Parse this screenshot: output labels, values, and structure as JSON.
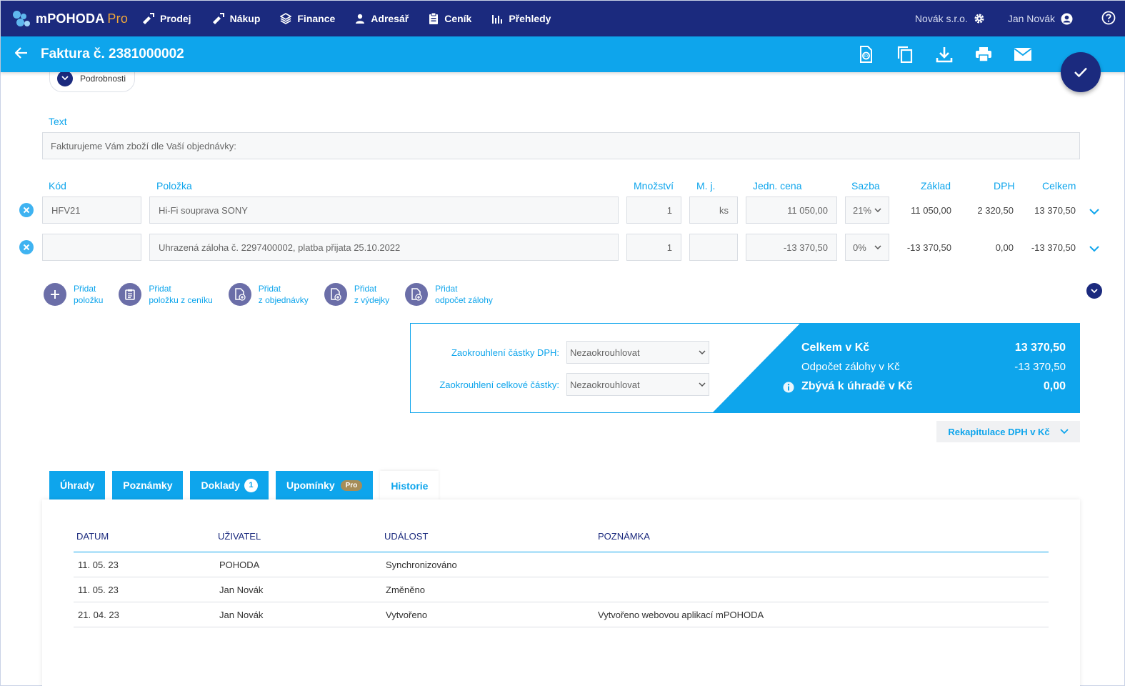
{
  "nav": {
    "app_name": "mPOHODA",
    "app_suffix": "Pro",
    "items": [
      {
        "label": "Prodej",
        "icon": "sell-icon"
      },
      {
        "label": "Nákup",
        "icon": "purchase-icon"
      },
      {
        "label": "Finance",
        "icon": "finance-icon"
      },
      {
        "label": "Adresář",
        "icon": "person-icon"
      },
      {
        "label": "Ceník",
        "icon": "pricelist-icon"
      },
      {
        "label": "Přehledy",
        "icon": "chart-icon"
      }
    ],
    "company": "Novák s.r.o.",
    "user": "Jan Novák"
  },
  "header": {
    "title": "Faktura č. 2381000002",
    "actions": [
      "isdoc-icon",
      "copy-icon",
      "download-icon",
      "print-icon",
      "email-icon"
    ]
  },
  "details_toggle": "Podrobnosti",
  "text_section": {
    "label": "Text",
    "value": "Fakturujeme Vám zboží dle Vaší objednávky:"
  },
  "items_table": {
    "headers": {
      "code": "Kód",
      "item": "Položka",
      "qty": "Množství",
      "unit": "M. j.",
      "unit_price": "Jedn. cena",
      "rate": "Sazba",
      "base": "Základ",
      "vat": "DPH",
      "total": "Celkem"
    },
    "rows": [
      {
        "code": "HFV21",
        "item": "Hi-Fi souprava SONY",
        "qty": "1",
        "unit": "ks",
        "unit_price": "11 050,00",
        "rate": "21%",
        "base": "11 050,00",
        "vat": "2 320,50",
        "total": "13 370,50"
      },
      {
        "code": "",
        "item": "Uhrazená záloha č. 2297400002, platba přijata 25.10.2022",
        "qty": "1",
        "unit": "",
        "unit_price": "-13 370,50",
        "rate": "0%",
        "base": "-13 370,50",
        "vat": "0,00",
        "total": "-13 370,50"
      }
    ]
  },
  "add_actions": [
    {
      "line1": "Přidat",
      "line2": "položku",
      "icon": "plus-icon"
    },
    {
      "line1": "Přidat",
      "line2": "položku z ceníku",
      "icon": "clipboard-icon"
    },
    {
      "line1": "Přidat",
      "line2": "z objednávky",
      "icon": "order-doc-icon"
    },
    {
      "line1": "Přidat",
      "line2": "z výdejky",
      "icon": "issue-doc-icon"
    },
    {
      "line1": "Přidat",
      "line2": "odpočet zálohy",
      "icon": "deposit-doc-icon"
    }
  ],
  "rounding": {
    "vat_label": "Zaokrouhlení částky DPH:",
    "vat_value": "Nezaokrouhlovat",
    "total_label": "Zaokrouhlení celkové částky:",
    "total_value": "Nezaokrouhlovat"
  },
  "totals": {
    "total_label": "Celkem v Kč",
    "total_value": "13 370,50",
    "deposit_label": "Odpočet zálohy v Kč",
    "deposit_value": "-13 370,50",
    "remaining_label": "Zbývá k úhradě v Kč",
    "remaining_value": "0,00"
  },
  "recap_label": "Rekapitulace DPH v Kč",
  "tabs": [
    {
      "label": "Úhrady"
    },
    {
      "label": "Poznámky"
    },
    {
      "label": "Doklady",
      "badge": "1"
    },
    {
      "label": "Upomínky",
      "pro": "Pro"
    },
    {
      "label": "Historie",
      "active": true
    }
  ],
  "history": {
    "headers": {
      "date": "DATUM",
      "user": "UŽIVATEL",
      "event": "UDÁLOST",
      "note": "POZNÁMKA"
    },
    "rows": [
      {
        "date": "11. 05. 23",
        "user": "POHODA",
        "event": "Synchronizováno",
        "note": ""
      },
      {
        "date": "11. 05. 23",
        "user": "Jan Novák",
        "event": "Změněno",
        "note": ""
      },
      {
        "date": "21. 04. 23",
        "user": "Jan Novák",
        "event": "Vytvořeno",
        "note": "Vytvořeno webovou aplikací mPOHODA"
      }
    ]
  },
  "colors": {
    "navy": "#1b2a7e",
    "accent": "#0ea5ec",
    "brand_pro": "#f0a73a"
  }
}
